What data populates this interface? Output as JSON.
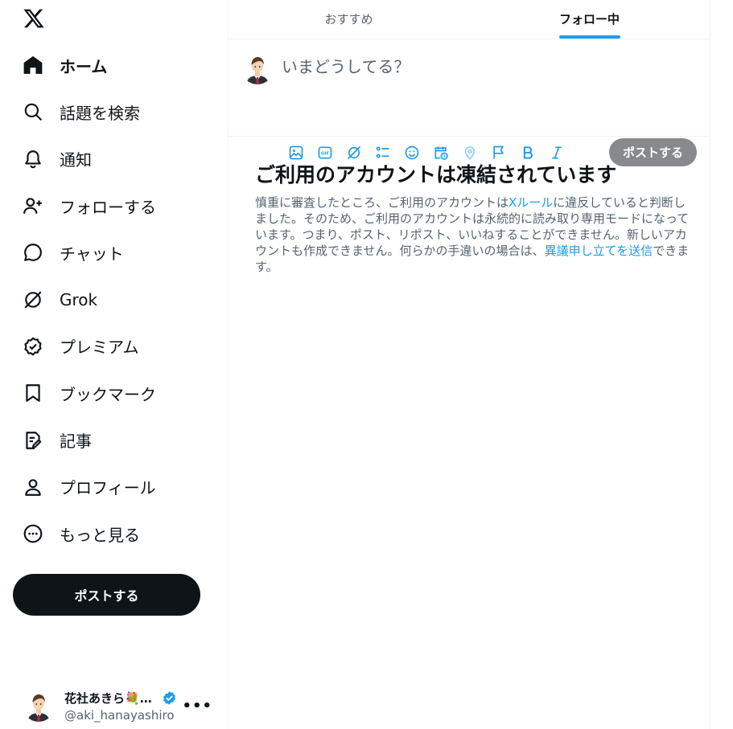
{
  "colors": {
    "text": "#0f1419",
    "muted": "#536471",
    "accent": "#1d9bf0",
    "border": "#eff3f4",
    "post_button_dark": "#0f1419",
    "post_button_disabled": "#87898c"
  },
  "sidebar": {
    "logo_icon": "x-logo-icon",
    "items": [
      {
        "label": "ホーム",
        "icon": "home-icon",
        "active": true
      },
      {
        "label": "話題を検索",
        "icon": "search-icon"
      },
      {
        "label": "通知",
        "icon": "bell-icon"
      },
      {
        "label": "フォローする",
        "icon": "follow-icon"
      },
      {
        "label": "チャット",
        "icon": "chat-icon"
      },
      {
        "label": "Grok",
        "icon": "grok-icon"
      },
      {
        "label": "プレミアム",
        "icon": "premium-icon"
      },
      {
        "label": "ブックマーク",
        "icon": "bookmark-icon"
      },
      {
        "label": "記事",
        "icon": "article-icon"
      },
      {
        "label": "プロフィール",
        "icon": "profile-icon"
      },
      {
        "label": "もっと見る",
        "icon": "more-icon"
      }
    ],
    "post_button": "ポストする",
    "account": {
      "display_name": "花社あきら💐エンジニア",
      "handle": "@aki_hanayashiro",
      "more": "•••"
    }
  },
  "main": {
    "tabs": [
      {
        "label": "おすすめ",
        "active": false
      },
      {
        "label": "フォロー中",
        "active": true
      }
    ],
    "composer": {
      "placeholder": "いまどうしてる？",
      "tools": [
        "image-icon",
        "gif-icon",
        "grok-icon",
        "poll-icon",
        "emoji-icon",
        "schedule-icon",
        "location-icon",
        "flag-icon",
        "bold-icon",
        "italic-icon"
      ],
      "post_button": "ポストする"
    },
    "notice": {
      "title": "ご利用のアカウントは凍結されています",
      "body_part1": "慎重に審査したところ、ご利用のアカウントは",
      "rules_link": "Xルール",
      "body_part2": "に違反していると判断しました。そのため、ご利用のアカウントは永続的に読み取り専用モードになっています。つまり、ポスト、リポスト、いいねすることができません。新しいアカウントも作成できません。何らかの手違いの場合は、",
      "appeal_link": "異議申し立てを送信",
      "body_part3": "できます。"
    }
  }
}
